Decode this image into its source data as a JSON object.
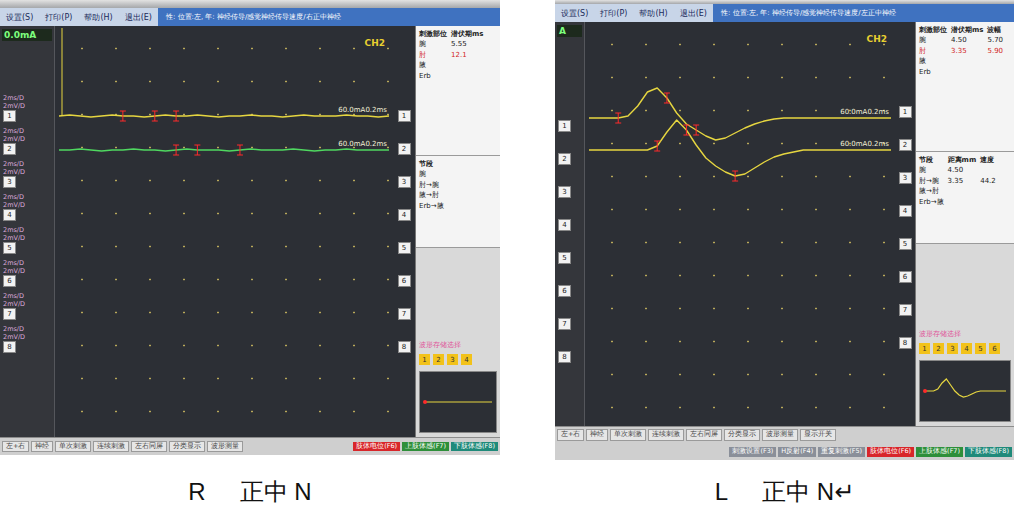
{
  "screens": [
    {
      "menu": [
        "设置(S)",
        "打印(P)",
        "帮助(H)",
        "退出(E)"
      ],
      "title": "性: 位置:左, 年: 神经传导/感觉神经传导速度/右正中神经",
      "stimulus": "0.0mA",
      "channel": "CH2",
      "sidebar": [
        {
          "number": "1",
          "scales": [
            "2ms/D",
            "2mV/D"
          ]
        },
        {
          "number": "2",
          "scales": [
            "2ms/D",
            "2mV/D"
          ]
        },
        {
          "number": "3",
          "scales": [
            "2ms/D",
            "2mV/D"
          ]
        },
        {
          "number": "4",
          "scales": [
            "2ms/D",
            "2mV/D"
          ]
        },
        {
          "number": "5",
          "scales": [
            "2ms/D",
            "2mV/D"
          ]
        },
        {
          "number": "6",
          "scales": [
            "2ms/D",
            "2mV/D"
          ]
        },
        {
          "number": "7",
          "scales": [
            "2ms/D",
            "2mV/D"
          ]
        },
        {
          "number": "8",
          "scales": [
            "2ms/D",
            "2mV/D"
          ]
        }
      ],
      "traces": [
        {
          "label": "60.0mA0.2ms",
          "color": "#e6d640",
          "values": [
            0,
            1,
            0,
            -1,
            0,
            1,
            0,
            0,
            -1,
            0,
            1,
            0,
            0,
            1,
            0,
            -1,
            0,
            0,
            1,
            0,
            0,
            -1,
            0,
            1,
            0,
            0,
            0,
            1,
            0,
            0,
            -1,
            0
          ],
          "markers": [
            6,
            9,
            11
          ]
        },
        {
          "label": "60.0mA0.2ms",
          "color": "#4fd860",
          "values": [
            0,
            0,
            1,
            0,
            -1,
            0,
            0,
            1,
            0,
            0,
            -1,
            0,
            1,
            0,
            0,
            0,
            -1,
            0,
            1,
            0,
            0,
            0,
            1,
            0,
            -1,
            0,
            0,
            1,
            0,
            0,
            0,
            0
          ],
          "markers": [
            11,
            13,
            17
          ]
        }
      ],
      "channel_numbers": [
        "1",
        "2",
        "3",
        "4",
        "5",
        "6",
        "7",
        "8"
      ],
      "results": {
        "headers": [
          "刺激部位",
          "潜伏期ms"
        ],
        "rows": [
          {
            "site": "腕",
            "values": [
              "5.55"
            ],
            "highlighted": false
          },
          {
            "site": "肘",
            "values": [
              "12.1"
            ],
            "highlighted": true
          },
          {
            "site": "腋",
            "values": [],
            "highlighted": false
          },
          {
            "site": "Erb",
            "values": [],
            "highlighted": false
          }
        ]
      },
      "segments": {
        "headers": [
          "节段"
        ],
        "rows": [
          {
            "site": "腕",
            "values": []
          },
          {
            "site": "肘→腕",
            "values": []
          },
          {
            "site": "腋→肘",
            "values": []
          },
          {
            "site": "Erb→腋",
            "values": []
          }
        ]
      },
      "store_label": "波形存储选择",
      "pages": [
        {
          "label": "1",
          "selected": false
        },
        {
          "label": "2",
          "selected": false
        },
        {
          "label": "3",
          "selected": false
        },
        {
          "label": "4",
          "selected": false
        }
      ],
      "preview": [
        0,
        0,
        0,
        0,
        0,
        0,
        0,
        0,
        0,
        0,
        0,
        0,
        0,
        0,
        0,
        0,
        0,
        0,
        0,
        0
      ],
      "buttons": [
        "左+右",
        "神经",
        "单次刺激",
        "连续刺激",
        "左右同屏",
        "分类显示",
        "波形测量"
      ],
      "function_keys": [
        {
          "label": "肢体电位(F6)",
          "color": "#d8262a"
        },
        {
          "label": "上肢体感(F7)",
          "color": "#2e8f3a"
        },
        {
          "label": "下肢体感(F8)",
          "color": "#1f8a7a"
        }
      ]
    },
    {
      "menu": [
        "设置(S)",
        "打印(P)",
        "帮助(H)",
        "退出(E)"
      ],
      "title": "性: 位置:左, 年: 神经传导/感觉神经传导速度/左正中神经",
      "stimulus": "A",
      "channel": "CH2",
      "sidebar": [
        {
          "number": "1",
          "scales": []
        },
        {
          "number": "2",
          "scales": []
        },
        {
          "number": "3",
          "scales": []
        },
        {
          "number": "4",
          "scales": []
        },
        {
          "number": "5",
          "scales": []
        },
        {
          "number": "6",
          "scales": []
        },
        {
          "number": "7",
          "scales": []
        },
        {
          "number": "8",
          "scales": []
        }
      ],
      "traces": [
        {
          "label": "60.0mA0.2ms",
          "color": "#e6d640",
          "values": [
            0,
            0,
            0,
            0,
            2,
            12,
            26,
            30,
            20,
            5,
            -6,
            -12,
            -18,
            -22,
            -20,
            -15,
            -10,
            -6,
            -3,
            -1,
            0,
            0,
            0,
            0,
            0,
            0,
            0,
            0,
            0,
            0,
            0,
            0
          ],
          "markers": [
            3,
            8,
            11
          ]
        },
        {
          "label": "60.0mA0.2ms",
          "color": "#e6d640",
          "values": [
            0,
            0,
            0,
            0,
            0,
            0,
            0,
            4,
            18,
            30,
            20,
            5,
            -8,
            -16,
            -22,
            -26,
            -24,
            -18,
            -12,
            -7,
            -4,
            -2,
            0,
            0,
            0,
            0,
            0,
            0,
            0,
            0,
            0,
            0
          ],
          "markers": [
            7,
            10,
            15
          ]
        }
      ],
      "channel_numbers": [
        "1",
        "2",
        "3",
        "4",
        "5",
        "6",
        "7",
        "8"
      ],
      "results": {
        "headers": [
          "刺激部位",
          "潜伏期ms",
          "波幅"
        ],
        "rows": [
          {
            "site": "腕",
            "values": [
              "4.50",
              "5.70"
            ],
            "highlighted": false
          },
          {
            "site": "肘",
            "values": [
              "3.35",
              "5.90"
            ],
            "highlighted": true
          },
          {
            "site": "腋",
            "values": [],
            "highlighted": false
          },
          {
            "site": "Erb",
            "values": [],
            "highlighted": false
          }
        ]
      },
      "segments": {
        "headers": [
          "节段",
          "距离mm",
          "速度"
        ],
        "rows": [
          {
            "site": "腕",
            "values": [
              "4.50"
            ]
          },
          {
            "site": "肘→腕",
            "values": [
              "3.35",
              "44.2"
            ]
          },
          {
            "site": "腋→肘",
            "values": []
          },
          {
            "site": "Erb→腋",
            "values": []
          }
        ]
      },
      "store_label": "波形存储选择",
      "pages": [
        {
          "label": "1",
          "selected": false
        },
        {
          "label": "2",
          "selected": false
        },
        {
          "label": "3",
          "selected": false
        },
        {
          "label": "4",
          "selected": false
        },
        {
          "label": "5",
          "selected": false
        },
        {
          "label": "6",
          "selected": false
        }
      ],
      "preview": [
        0,
        0,
        0,
        2,
        8,
        12,
        6,
        0,
        -4,
        -6,
        -5,
        -3,
        -1,
        0,
        0,
        0,
        0,
        0,
        0,
        0
      ],
      "buttons": [
        "左+右",
        "神经",
        "单次刺激",
        "连续刺激",
        "左右同屏",
        "分类显示",
        "波形测量",
        "显示开关"
      ],
      "function_keys": [
        {
          "label": "刺激设置(F3)",
          "color": "#8a8f99"
        },
        {
          "label": "H反射(F4)",
          "color": "#8a8f99"
        },
        {
          "label": "重复刺激(F5)",
          "color": "#8a8f99"
        },
        {
          "label": "肢体电位(F6)",
          "color": "#d8262a"
        },
        {
          "label": "上肢体感(F7)",
          "color": "#2e8f3a"
        },
        {
          "label": "下肢体感(F8)",
          "color": "#1f8a7a"
        }
      ]
    }
  ],
  "captions": [
    {
      "side": "R",
      "nerve": "正中 N"
    },
    {
      "side": "L",
      "nerve": "正中 N↵"
    }
  ]
}
